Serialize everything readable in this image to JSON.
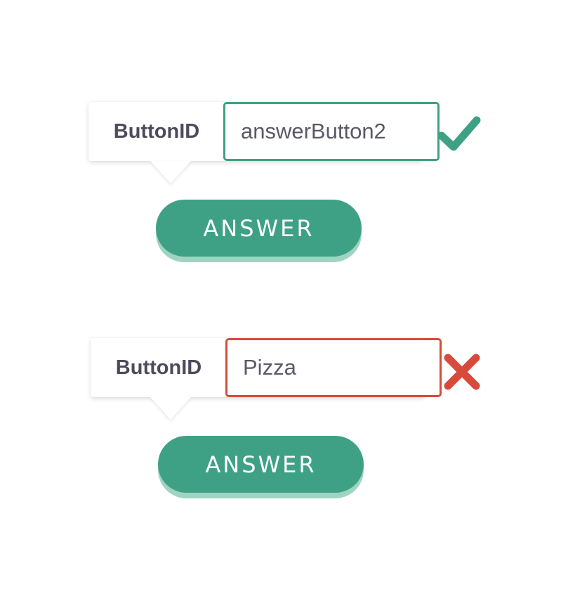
{
  "colors": {
    "valid": "#3ea185",
    "invalid": "#d84a3b",
    "button": "#3ea185",
    "button_shadow": "#9fd4c2",
    "label_text": "#4d4a5c"
  },
  "examples": [
    {
      "label": "ButtonID",
      "value": "answerButton2",
      "state": "valid",
      "status_icon": "checkmark-icon",
      "button_label": "ANSWER"
    },
    {
      "label": "ButtonID",
      "value": "Pizza",
      "state": "invalid",
      "status_icon": "cross-icon",
      "button_label": "ANSWER"
    }
  ]
}
